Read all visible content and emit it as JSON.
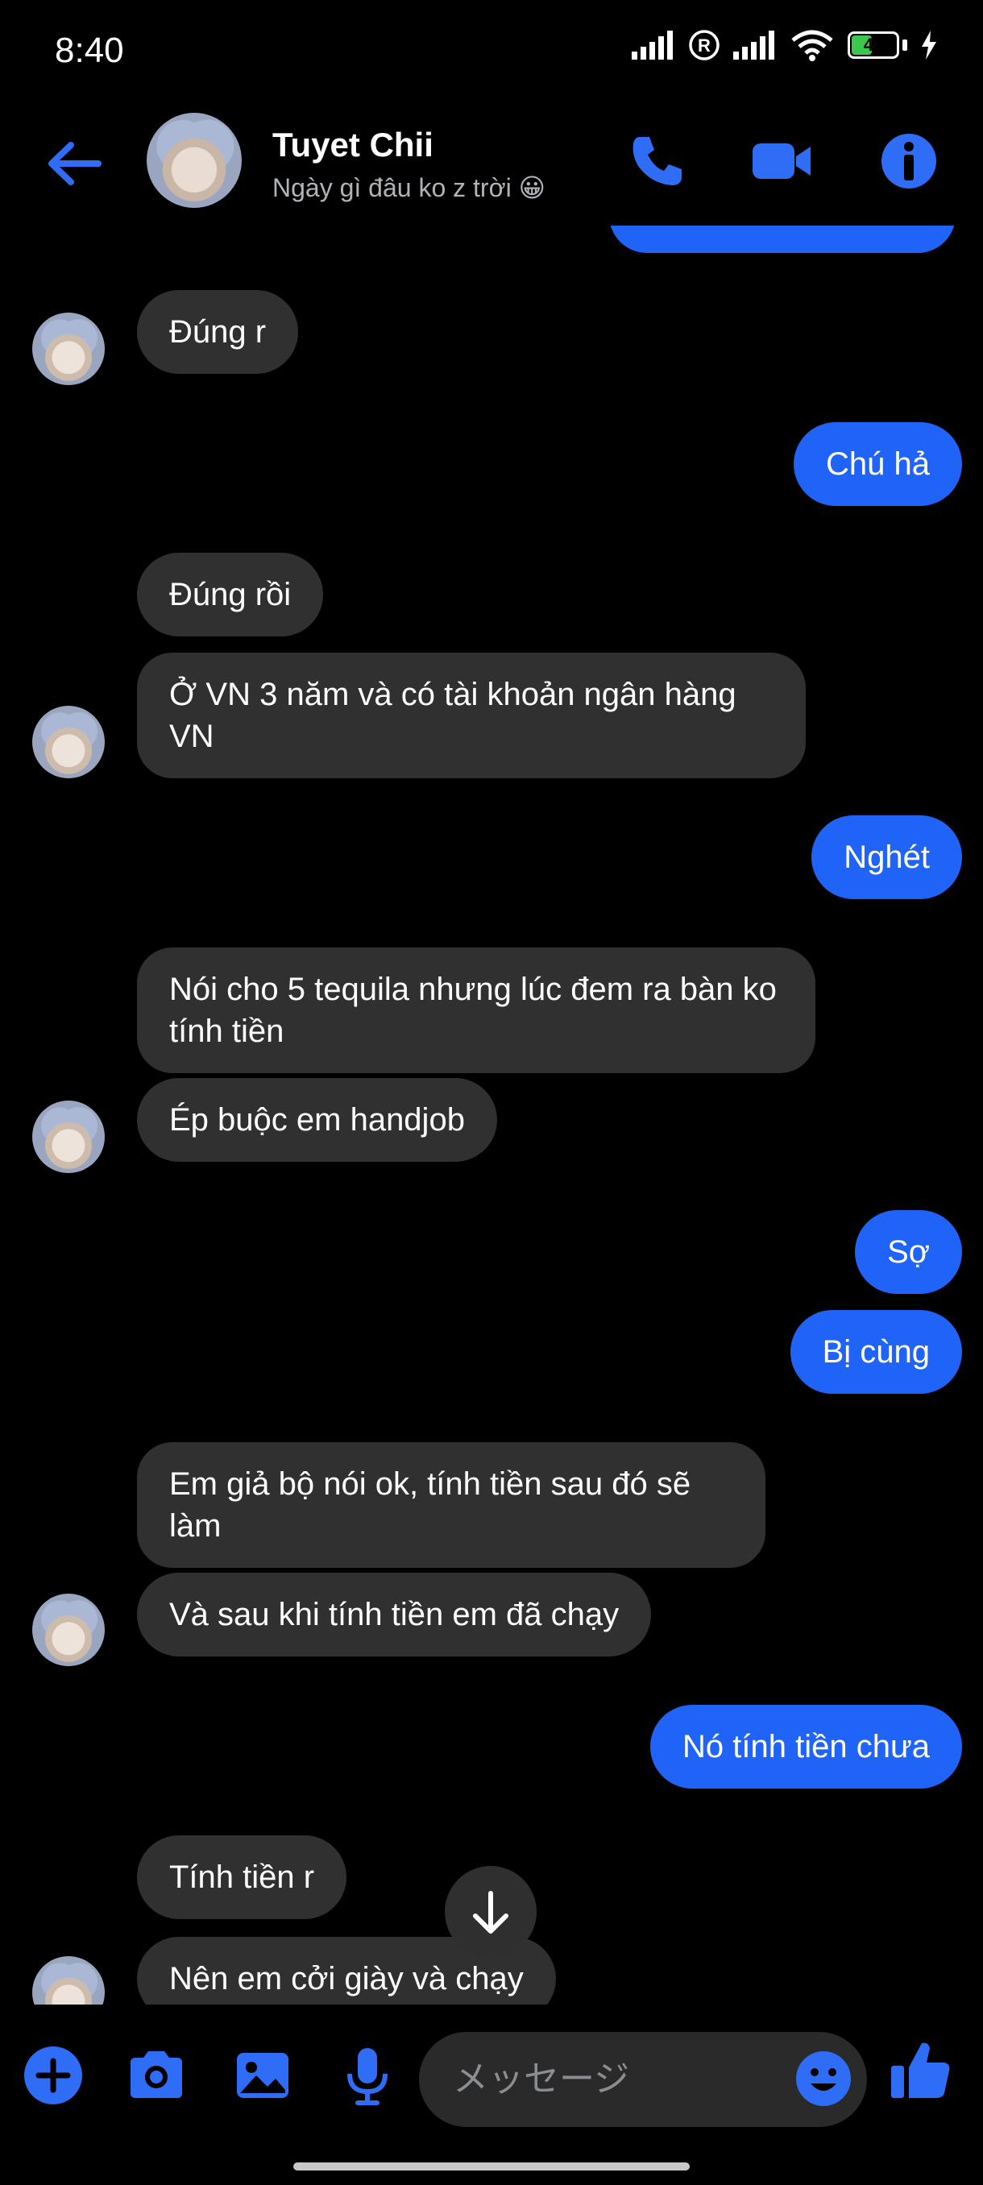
{
  "status_bar": {
    "time": "8:40",
    "battery": "46",
    "battery_level_percent": 46
  },
  "header": {
    "contact_name": "Tuyet Chii",
    "contact_status": "Ngày gì đâu ko z trời 😀"
  },
  "messages": [
    {
      "side": "in",
      "text": "Đúng r"
    },
    {
      "side": "out",
      "text": "Chú hả"
    },
    {
      "side": "in",
      "text": "Đúng rồi"
    },
    {
      "side": "in",
      "text": "Ở VN 3 năm và có tài khoản ngân hàng VN"
    },
    {
      "side": "out",
      "text": "Nghét"
    },
    {
      "side": "in",
      "text": "Nói cho 5 tequila nhưng lúc đem ra bàn ko tính tiền"
    },
    {
      "side": "in",
      "text": "Ép buộc em handjob"
    },
    {
      "side": "out",
      "text": "Sợ"
    },
    {
      "side": "out",
      "text": "Bị cùng"
    },
    {
      "side": "in",
      "text": "Em giả bộ nói ok, tính tiền sau đó sẽ làm"
    },
    {
      "side": "in",
      "text": "Và sau khi tính tiền em đã chạy"
    },
    {
      "side": "out",
      "text": "Nó tính tiền chưa"
    },
    {
      "side": "in",
      "text": "Tính tiền r"
    },
    {
      "side": "in",
      "text": "Nên em cởi giày và chạy"
    }
  ],
  "composer": {
    "placeholder": "メッセージ"
  },
  "colors": {
    "accent": "#2064f7",
    "incoming_bubble": "#303030",
    "background": "#000000"
  }
}
